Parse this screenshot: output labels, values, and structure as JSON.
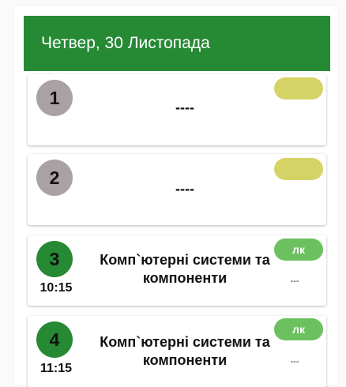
{
  "header": {
    "title": "Четвер, 30 Листопада"
  },
  "lessons": [
    {
      "number": "1",
      "time": "",
      "subject": "----",
      "type": "",
      "room": ""
    },
    {
      "number": "2",
      "time": "",
      "subject": "----",
      "type": "",
      "room": ""
    },
    {
      "number": "3",
      "time": "10:15",
      "subject": "Комп`ютерні системи та компоненти",
      "type": "лк",
      "room": "---"
    },
    {
      "number": "4",
      "time": "11:15",
      "subject": "Комп`ютерні системи та компоненти",
      "type": "лк",
      "room": "---"
    }
  ],
  "colors": {
    "header_bg": "#268a35",
    "circle_inactive": "#aaa1a5",
    "circle_active": "#268a35",
    "badge_empty": "#d5d366",
    "badge_lecture": "#6cc060"
  }
}
